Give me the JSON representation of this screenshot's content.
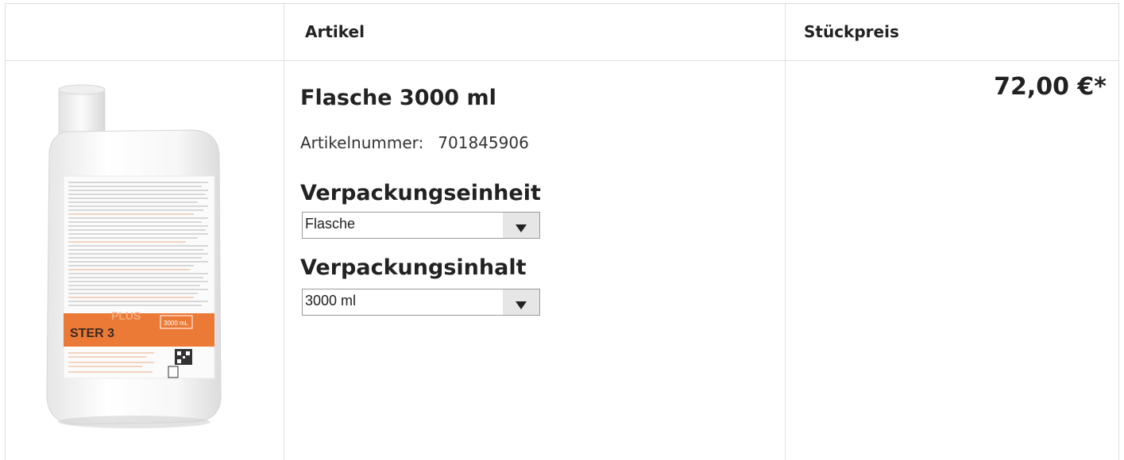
{
  "header": {
    "article_label": "Artikel",
    "unit_price_label": "Stückpreis"
  },
  "product": {
    "image_name": "STER 3 PLUS 3000 ml bottle",
    "title": "Flasche 3000 ml",
    "article_number_label": "Artikelnummer:",
    "article_number": "701845906",
    "packaging_unit_label": "Verpackungseinheit",
    "packaging_unit_selected": "Flasche",
    "packaging_content_label": "Verpackungsinhalt",
    "packaging_content_selected": "3000 ml",
    "price": "72,00 €*"
  },
  "label_text": {
    "brand": "STER 3",
    "sub": "PLUS",
    "volume": "3000 mL"
  }
}
